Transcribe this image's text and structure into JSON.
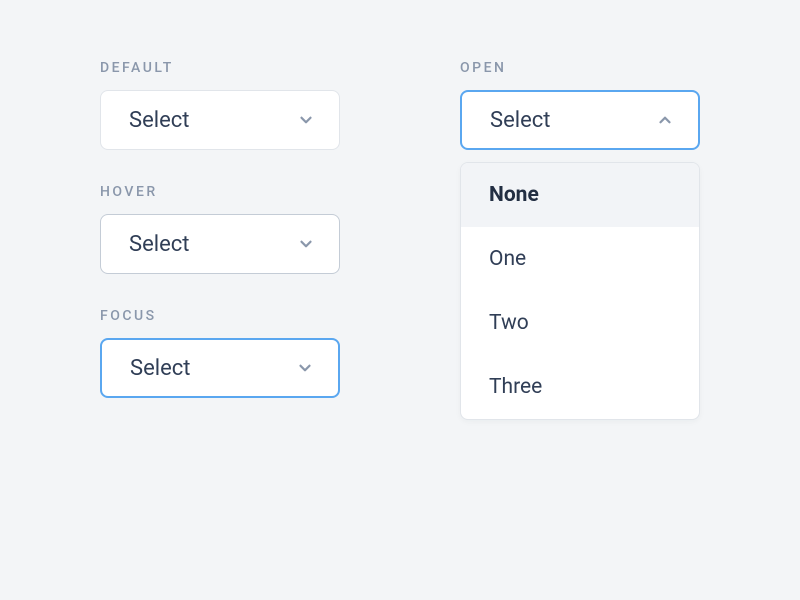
{
  "left": {
    "default": {
      "label": "DEFAULT",
      "value": "Select"
    },
    "hover": {
      "label": "HOVER",
      "value": "Select"
    },
    "focus": {
      "label": "FOCUS",
      "value": "Select"
    }
  },
  "right": {
    "open": {
      "label": "OPEN",
      "value": "Select",
      "options": [
        "None",
        "One",
        "Two",
        "Three"
      ],
      "highlighted_index": 0
    }
  }
}
